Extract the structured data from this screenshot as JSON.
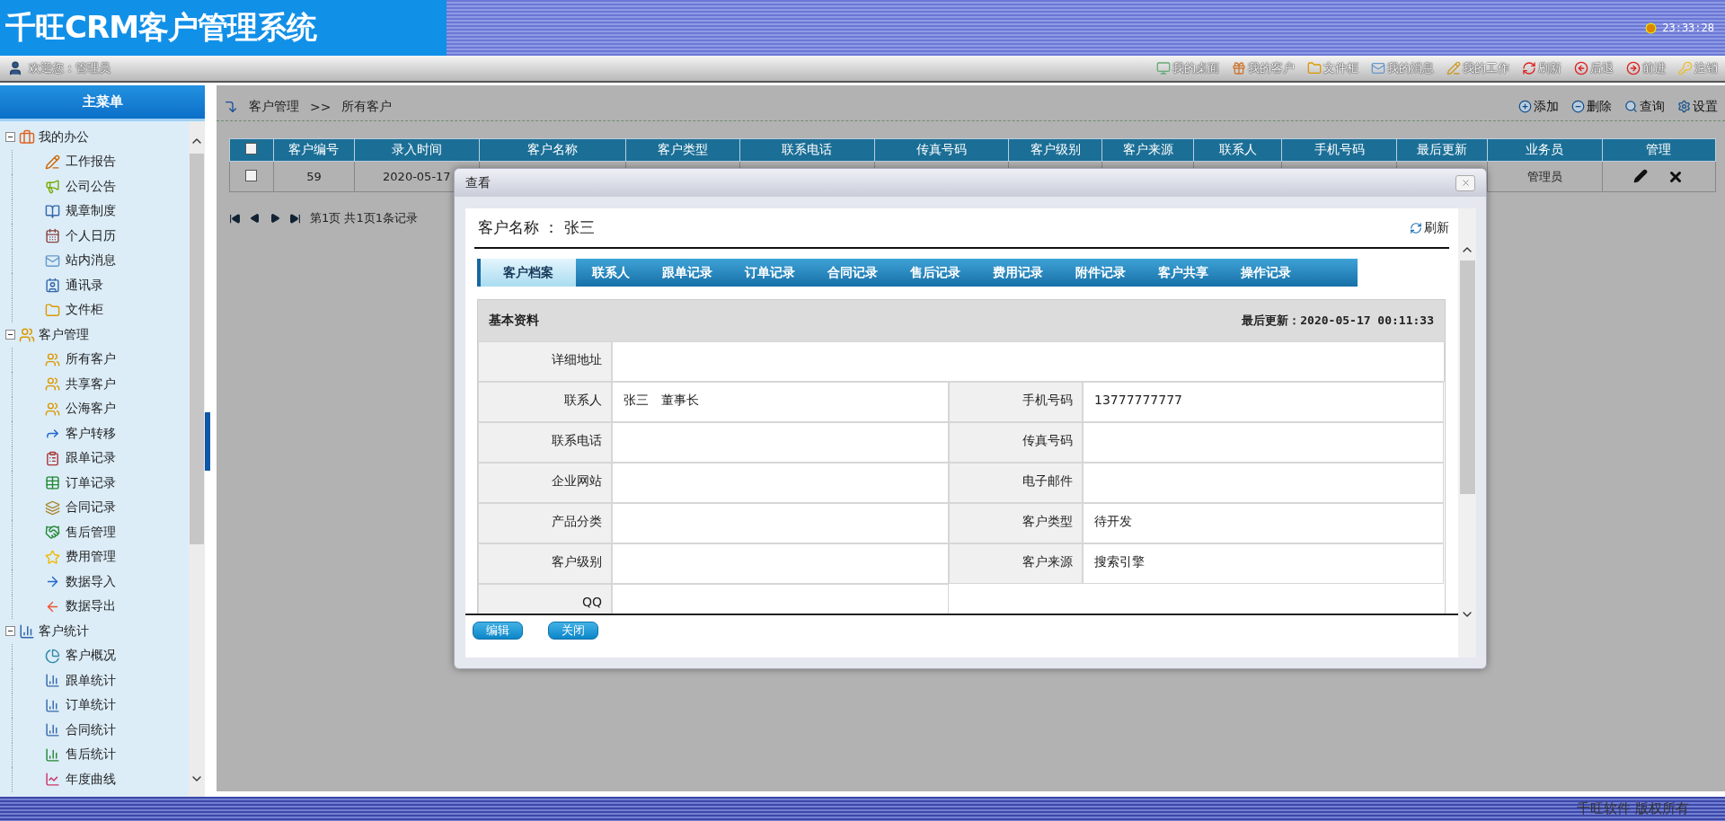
{
  "header": {
    "logo": "千旺CRM客户管理系统",
    "clock": "23:33:28"
  },
  "toolbar": {
    "welcome": "欢迎您：管理员",
    "links": [
      {
        "label": "我的桌面"
      },
      {
        "label": "我的客户"
      },
      {
        "label": "文件柜"
      },
      {
        "label": "我的消息"
      },
      {
        "label": "我的工作"
      },
      {
        "label": "刷新"
      },
      {
        "label": "后退"
      },
      {
        "label": "前进"
      },
      {
        "label": "注销"
      }
    ]
  },
  "sidebar": {
    "title": "主菜单",
    "groups": [
      {
        "label": "我的办公",
        "expanded": true,
        "children": [
          {
            "label": "工作报告"
          },
          {
            "label": "公司公告"
          },
          {
            "label": "规章制度"
          },
          {
            "label": "个人日历"
          },
          {
            "label": "站内消息"
          },
          {
            "label": "通讯录"
          },
          {
            "label": "文件柜"
          }
        ]
      },
      {
        "label": "客户管理",
        "expanded": true,
        "children": [
          {
            "label": "所有客户"
          },
          {
            "label": "共享客户"
          },
          {
            "label": "公海客户"
          },
          {
            "label": "客户转移"
          },
          {
            "label": "跟单记录"
          },
          {
            "label": "订单记录"
          },
          {
            "label": "合同记录"
          },
          {
            "label": "售后管理"
          },
          {
            "label": "费用管理"
          },
          {
            "label": "数据导入"
          },
          {
            "label": "数据导出"
          }
        ]
      },
      {
        "label": "客户统计",
        "expanded": true,
        "children": [
          {
            "label": "客户概况"
          },
          {
            "label": "跟单统计"
          },
          {
            "label": "订单统计"
          },
          {
            "label": "合同统计"
          },
          {
            "label": "售后统计"
          },
          {
            "label": "年度曲线"
          }
        ]
      }
    ]
  },
  "breadcrumb": [
    "客户管理",
    ">>",
    "所有客户"
  ],
  "actions": [
    {
      "label": "添加"
    },
    {
      "label": "删除"
    },
    {
      "label": "查询"
    },
    {
      "label": "设置"
    }
  ],
  "table": {
    "columns": [
      "客户编号",
      "录入时间",
      "客户名称",
      "客户类型",
      "联系电话",
      "传真号码",
      "客户级别",
      "客户来源",
      "联系人",
      "手机号码",
      "最后更新",
      "业务员",
      "管理"
    ],
    "all_checked": false,
    "rows": [
      {
        "checked": false,
        "id": "59",
        "entered": "2020-05-17",
        "salesperson": "管理员"
      }
    ]
  },
  "pager": "第1页 共1页1条记录",
  "dialog": {
    "title": "查看",
    "customer": "客户名称 ： 张三",
    "refresh": "刷新",
    "tabs": [
      {
        "label": "客户档案",
        "selected": true
      },
      {
        "label": "联系人",
        "selected": false
      },
      {
        "label": "跟单记录",
        "selected": false
      },
      {
        "label": "订单记录",
        "selected": false
      },
      {
        "label": "合同记录",
        "selected": false
      },
      {
        "label": "售后记录",
        "selected": false
      },
      {
        "label": "费用记录",
        "selected": false
      },
      {
        "label": "附件记录",
        "selected": false
      },
      {
        "label": "客户共享",
        "selected": false
      },
      {
        "label": "操作记录",
        "selected": false
      }
    ],
    "section": "基本资料",
    "updated": "最后更新：2020-05-17 00:11:33",
    "rows": [
      {
        "cells": [
          {
            "label": "详细地址"
          }
        ]
      },
      {
        "cells": [
          {
            "label": "联系人",
            "value": "张三　董事长"
          },
          {
            "label": "手机号码",
            "value": "13777777777"
          }
        ]
      },
      {
        "cells": [
          {
            "label": "联系电话"
          },
          {
            "label": "传真号码"
          }
        ]
      },
      {
        "cells": [
          {
            "label": "企业网站"
          },
          {
            "label": "电子邮件"
          }
        ]
      },
      {
        "cells": [
          {
            "label": "产品分类"
          },
          {
            "label": "客户类型",
            "value": "待开发"
          }
        ]
      },
      {
        "cells": [
          {
            "label": "客户级别"
          },
          {
            "label": "客户来源",
            "value": "搜索引擎"
          }
        ]
      },
      {
        "cells": [
          {
            "label": "QQ"
          }
        ]
      }
    ],
    "buttons": [
      "编辑",
      "关闭"
    ]
  },
  "footer": "千旺软件 版权所有"
}
